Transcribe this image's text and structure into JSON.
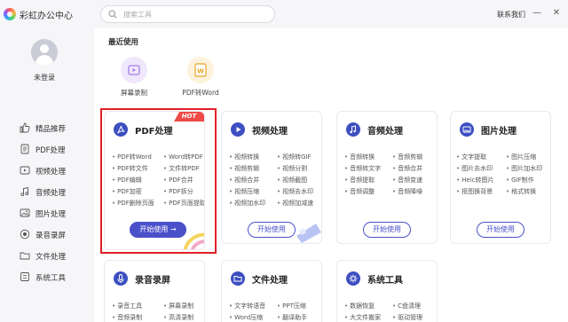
{
  "app": {
    "title": "彩虹办公中心"
  },
  "search": {
    "placeholder": "搜索工具"
  },
  "header": {
    "contact": "联系我们"
  },
  "user": {
    "login_label": "未登录"
  },
  "sidebar": {
    "items": [
      {
        "label": "精品推荐",
        "icon": "thumbs-up-icon"
      },
      {
        "label": "PDF处理",
        "icon": "pdf-icon"
      },
      {
        "label": "视频处理",
        "icon": "video-icon"
      },
      {
        "label": "音频处理",
        "icon": "music-icon"
      },
      {
        "label": "图片处理",
        "icon": "image-icon"
      },
      {
        "label": "录音录屏",
        "icon": "record-icon"
      },
      {
        "label": "文件处理",
        "icon": "folder-icon"
      },
      {
        "label": "系统工具",
        "icon": "tools-icon"
      }
    ]
  },
  "recent": {
    "title": "最近使用",
    "items": [
      {
        "label": "屏幕录制",
        "icon": "screen-record-icon"
      },
      {
        "label": "PDF转Word",
        "icon": "word-file-icon"
      }
    ]
  },
  "cards": [
    {
      "title": "PDF处理",
      "icon": "pdf-icon",
      "badge": "HOT",
      "button": "开始使用 →",
      "tools": [
        "PDF转Word",
        "Word转PDF",
        "PDF转文件",
        "文件转PDF",
        "PDF编辑",
        "PDF合并",
        "PDF加密",
        "PDF拆分",
        "PDF删除页面",
        "PDF页面提取"
      ]
    },
    {
      "title": "视频处理",
      "icon": "video-icon",
      "button": "开始使用",
      "tools": [
        "视频转换",
        "视频转GIF",
        "视频剪辑",
        "视频分割",
        "视频合并",
        "视频截图",
        "视频压缩",
        "视频去水印",
        "视频加水印",
        "视频加减速"
      ]
    },
    {
      "title": "音频处理",
      "icon": "music-icon",
      "button": "开始使用",
      "tools": [
        "音频转换",
        "音频剪辑",
        "音频转文字",
        "音频合并",
        "音频提取",
        "音频变速",
        "音频调整",
        "音频降噪"
      ]
    },
    {
      "title": "图片处理",
      "icon": "image-icon",
      "button": "开始使用",
      "tools": [
        "文字提取",
        "图片压缩",
        "图片去水印",
        "图片加水印",
        "Heic转图片",
        "GIF制作",
        "抠图换背景",
        "格式转换"
      ]
    },
    {
      "title": "录音录屏",
      "icon": "record-icon",
      "tools": [
        "录音工具",
        "屏幕录制",
        "音频录制",
        "高清录制"
      ]
    },
    {
      "title": "文件处理",
      "icon": "folder-icon",
      "tools": [
        "文字转语音",
        "PPT压缩",
        "Word压缩",
        "翻译助手"
      ]
    },
    {
      "title": "系统工具",
      "icon": "tools-icon",
      "tools": [
        "数据恢复",
        "C盘清理",
        "大文件搬家",
        "驱动管理"
      ]
    }
  ],
  "colors": {
    "accent": "#4a50c9",
    "hot": "#f04a48",
    "highlight": "#e01f26",
    "card_icon": "#3d4fc1"
  }
}
